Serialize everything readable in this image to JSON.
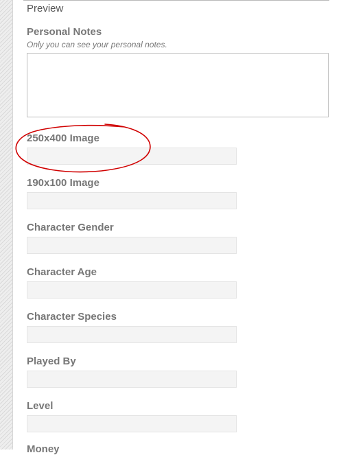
{
  "preview": {
    "label": "Preview"
  },
  "personal_notes": {
    "label": "Personal Notes",
    "hint": "Only you can see your personal notes.",
    "value": ""
  },
  "fields": [
    {
      "label": "250x400 Image",
      "value": ""
    },
    {
      "label": "190x100 Image",
      "value": ""
    },
    {
      "label": "Character Gender",
      "value": ""
    },
    {
      "label": "Character Age",
      "value": ""
    },
    {
      "label": "Character Species",
      "value": ""
    },
    {
      "label": "Played By",
      "value": ""
    },
    {
      "label": "Level",
      "value": ""
    },
    {
      "label": "Money",
      "value": ""
    }
  ],
  "colors": {
    "label_text": "#777777",
    "field_background": "#f4f4f4",
    "annotation_circle": "#d00000"
  }
}
